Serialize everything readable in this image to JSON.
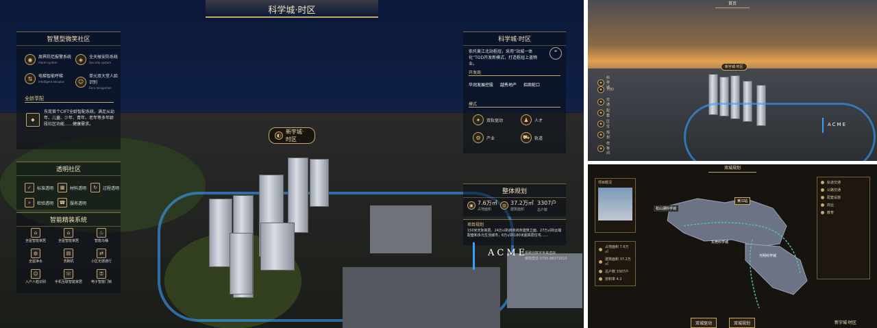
{
  "main": {
    "title": "科学城·时区",
    "smart_community": {
      "title": "智慧型微笑社区",
      "items": [
        {
          "label": "周界防范报警系统",
          "sub": "Alarm system"
        },
        {
          "label": "全天候安防系统",
          "sub": "Security system"
        },
        {
          "label": "电梯智能呼梯",
          "sub": "Intelligent elevator"
        },
        {
          "label": "单元双大堂人脸识别",
          "sub": "Face recognition"
        }
      ],
      "age_title": "全龄享配",
      "age_text": "东莞首个CIFT全龄智配系统，满足从幼年、儿童、少年、青年、老年等多年龄段社区功能……健康需求。"
    },
    "transparent": {
      "title": "透明社区",
      "items": [
        "标准透明",
        "材料透明",
        "过程透明",
        "检验透明",
        "服务透明"
      ]
    },
    "smart_home": {
      "title": "智能精装系统",
      "items": [
        "全屋智能家居",
        "全屋智能家居",
        "智能马桶",
        "全屋净水",
        "洗碗机",
        "小区无感通行",
        "入户人脸识别",
        "手机互联智能家居",
        "电子智能门锁"
      ]
    },
    "center_label": "新宇城·时区",
    "right_panel": {
      "title": "科学城·时区",
      "intro": "依托黄江北站枢纽，采用“站城一体化”TOD开发新模式，打造枢纽上盖物业。",
      "dev_title": "开发商",
      "developers": [
        "华润发展控股",
        "越秀地产",
        "招商蛇口"
      ],
      "mode_title": "模式",
      "modes": [
        "双轨驱动",
        "人才",
        "产业",
        "轨道"
      ]
    },
    "planning": {
      "title": "整体规划",
      "stats": [
        {
          "value": "7.6万㎡",
          "label": "占地面积"
        },
        {
          "value": "37.2万㎡",
          "label": "建筑面积"
        },
        {
          "value": "3307户",
          "label": "总户数"
        }
      ]
    },
    "scene": {
      "title": "项目规划",
      "text": "150米天际高层、24万㎡的商务商务建筑立面、27万㎡的云端配套和多元生活城市，6万㎡的180米超高层住宅……"
    },
    "brand": {
      "logo": "ACME",
      "line1": "极致创数字未来虚拟",
      "line2": "爆款营造 0755-88371610"
    }
  },
  "top_right": {
    "title": "首页",
    "center_label": "新宇城·时区",
    "side_items": [
      "科学城",
      "TOD",
      "交通",
      "配套",
      "区位",
      "规划",
      "样板间"
    ],
    "logo": "ACME"
  },
  "bottom_right": {
    "title": "双城规划",
    "map_labels": [
      "松山湖科学城",
      "黄江站",
      "光明科学城",
      "东莞科学城"
    ],
    "left_card_title": "项目概况",
    "left_rows": [
      "占地面积 7.6万㎡",
      "建筑面积 37.2万㎡",
      "总户数 3307户",
      "容积率 4.2"
    ],
    "right_rows": [
      "轨道交通",
      "公路交通",
      "配套设施",
      "商业",
      "教育"
    ],
    "buttons": [
      "双城驱动",
      "双城规划"
    ],
    "logo_label": "新宇城·时区"
  },
  "colors": {
    "gold": "#c9a96a",
    "night": "#0b1838",
    "water": "#3aa0ff"
  }
}
